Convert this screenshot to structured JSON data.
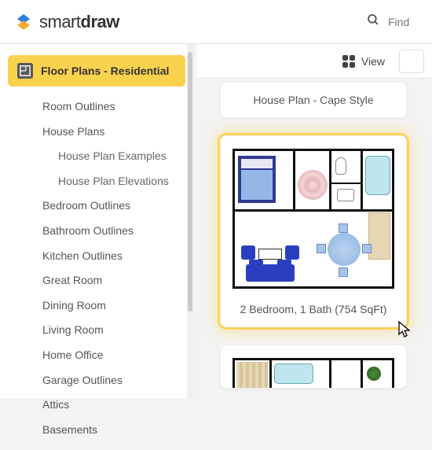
{
  "header": {
    "brand_light": "smart",
    "brand_bold": "draw",
    "search_placeholder": "Find"
  },
  "toolbar": {
    "view_label": "View"
  },
  "sidebar": {
    "category_label": "Floor Plans - Residential",
    "items": [
      {
        "label": "Room Outlines",
        "sub": false
      },
      {
        "label": "House Plans",
        "sub": false
      },
      {
        "label": "House Plan Examples",
        "sub": true
      },
      {
        "label": "House Plan Elevations",
        "sub": true
      },
      {
        "label": "Bedroom Outlines",
        "sub": false
      },
      {
        "label": "Bathroom Outlines",
        "sub": false
      },
      {
        "label": "Kitchen Outlines",
        "sub": false
      },
      {
        "label": "Great Room",
        "sub": false
      },
      {
        "label": "Dining Room",
        "sub": false
      },
      {
        "label": "Living Room",
        "sub": false
      },
      {
        "label": "Home Office",
        "sub": false
      },
      {
        "label": "Garage Outlines",
        "sub": false
      },
      {
        "label": "Attics",
        "sub": false
      },
      {
        "label": "Basements",
        "sub": false
      }
    ]
  },
  "templates": [
    {
      "caption": "House Plan - Cape Style"
    },
    {
      "caption": "2 Bedroom, 1 Bath (754 SqFt)"
    }
  ]
}
